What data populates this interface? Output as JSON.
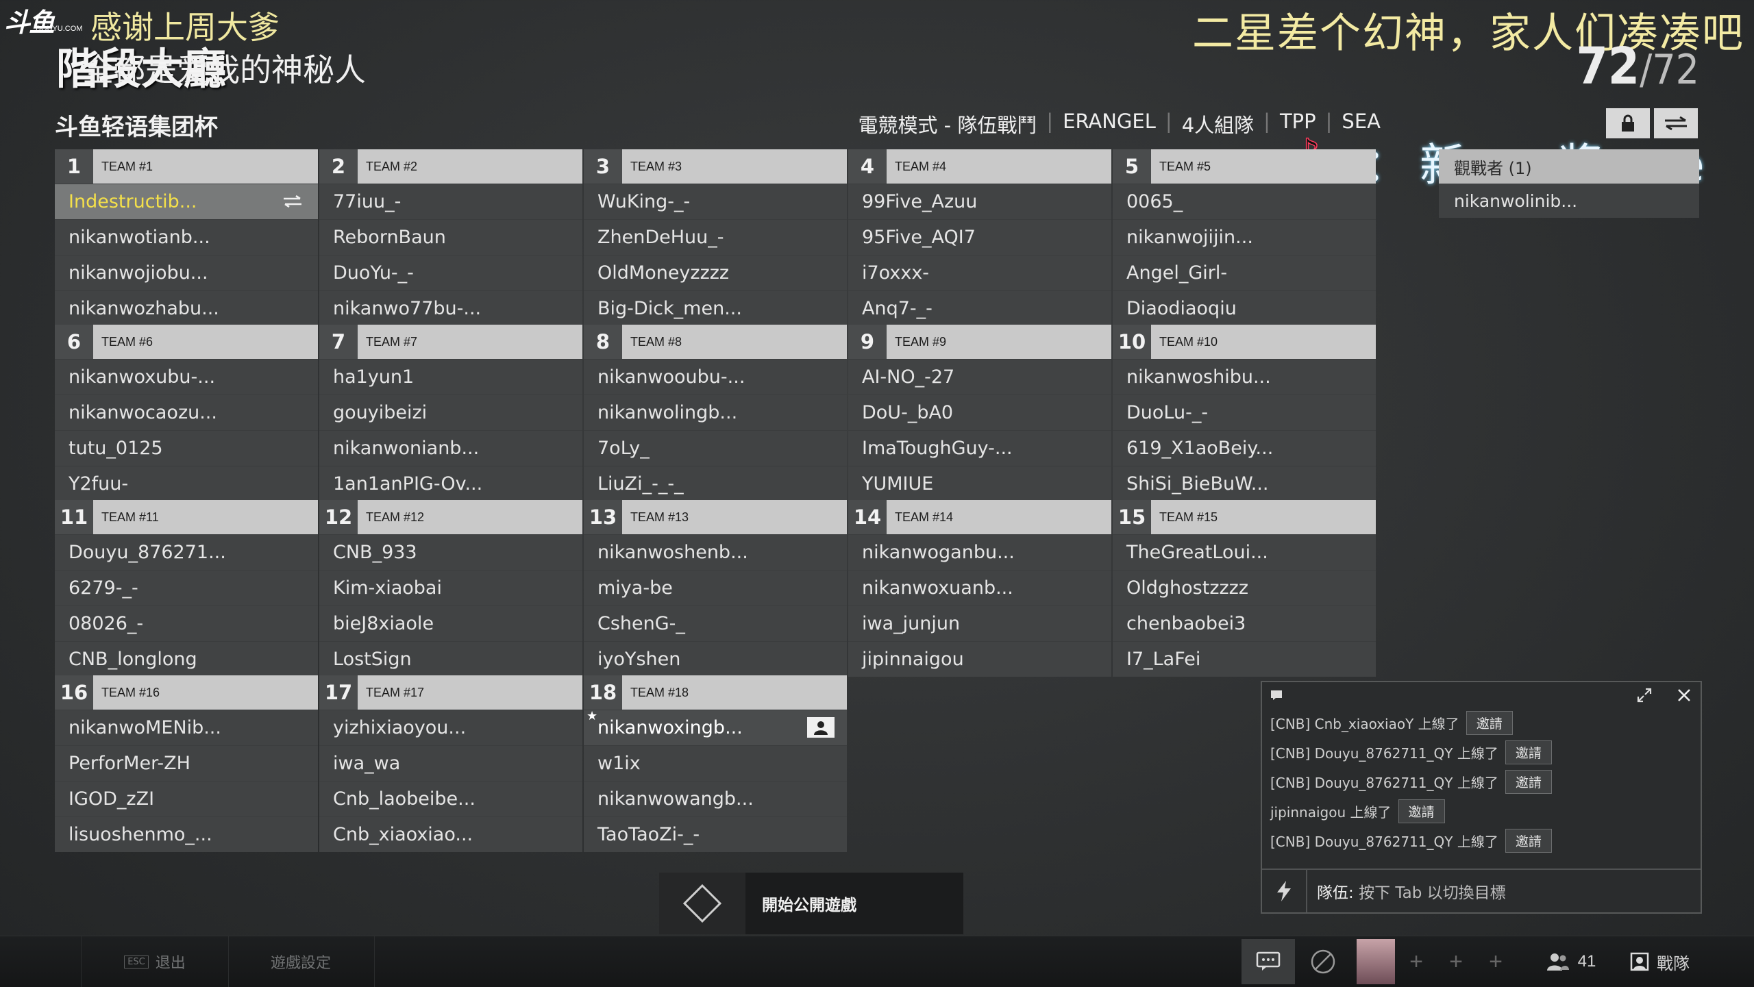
{
  "overlay": {
    "logo_text": "斗鱼",
    "logo_sub": "DOUYU.COM",
    "thanks": "感谢上周大爹",
    "phase": "階段大廳",
    "phase_sub": "全都是爱我的神秘人",
    "banner": "二星差个幻神，家人们凑凑吧",
    "tiktok_text": "：新一 浆 ve"
  },
  "player_count": {
    "current": "72",
    "total": "/72"
  },
  "header": {
    "title": "斗鱼轻语集团杯",
    "mode_items": [
      "電競模式 - 隊伍戰鬥",
      "ERANGEL",
      "4人組隊",
      "TPP",
      "SEA"
    ],
    "lock_icon": "lock-icon",
    "swap_icon": "swap-icon"
  },
  "teams": [
    {
      "num": "1",
      "name": "TEAM #1",
      "players": [
        "Indestructib...",
        "nikanwotianb...",
        "nikanwojiobu...",
        "nikanwozhabu..."
      ]
    },
    {
      "num": "2",
      "name": "TEAM #2",
      "players": [
        "77iuu_-",
        "RebornBaun",
        "DuoYu-_-",
        "nikanwo77bu-..."
      ]
    },
    {
      "num": "3",
      "name": "TEAM #3",
      "players": [
        "WuKing-_-",
        "ZhenDeHuu_-",
        "OldMoneyzzzz",
        "Big-Dick_men..."
      ]
    },
    {
      "num": "4",
      "name": "TEAM #4",
      "players": [
        "99Five_Azuu",
        "95Five_AQI7",
        "i7oxxx-",
        "Anq7-_-"
      ]
    },
    {
      "num": "5",
      "name": "TEAM #5",
      "players": [
        "0065_",
        "nikanwojijin...",
        "Angel_Girl-",
        "Diaodiaoqiu"
      ]
    },
    {
      "num": "6",
      "name": "TEAM #6",
      "players": [
        "nikanwoxubu-...",
        "nikanwocaozu...",
        "tutu_0125",
        "Y2fuu-"
      ]
    },
    {
      "num": "7",
      "name": "TEAM #7",
      "players": [
        "ha1yun1",
        "gouyibeizi",
        "nikanwonianb...",
        "1an1anPIG-Ov..."
      ]
    },
    {
      "num": "8",
      "name": "TEAM #8",
      "players": [
        "nikanwooubu-...",
        "nikanwolingb...",
        "7oLy_",
        "LiuZi_-_-_"
      ]
    },
    {
      "num": "9",
      "name": "TEAM #9",
      "players": [
        "AI-NO_-27",
        "DoU-_bA0",
        "ImaToughGuy-...",
        "YUMIUE"
      ]
    },
    {
      "num": "10",
      "name": "TEAM #10",
      "players": [
        "nikanwoshibu...",
        "DuoLu-_-",
        "619_X1aoBeiy...",
        "ShiSi_BieBuW..."
      ]
    },
    {
      "num": "11",
      "name": "TEAM #11",
      "players": [
        "Douyu_876271...",
        "6279-_-",
        "08026_-",
        "CNB_longlong"
      ]
    },
    {
      "num": "12",
      "name": "TEAM #12",
      "players": [
        "CNB_933",
        "Kim-xiaobai",
        "bieJ8xiaole",
        "LostSign"
      ]
    },
    {
      "num": "13",
      "name": "TEAM #13",
      "players": [
        "nikanwoshenb...",
        "miya-be",
        "CshenG-_",
        "iyoYshen"
      ]
    },
    {
      "num": "14",
      "name": "TEAM #14",
      "players": [
        "nikanwoganbu...",
        "nikanwoxuanb...",
        "iwa_junjun",
        "jipinnaigou"
      ]
    },
    {
      "num": "15",
      "name": "TEAM #15",
      "players": [
        "TheGreatLoui...",
        "Oldghostzzzz",
        "chenbaobei3",
        "I7_LaFei"
      ]
    },
    {
      "num": "16",
      "name": "TEAM #16",
      "players": [
        "nikanwoMENib...",
        "PerforMer-ZH",
        "IGOD_zZI",
        "lisuoshenmo_..."
      ]
    },
    {
      "num": "17",
      "name": "TEAM #17",
      "players": [
        "yizhixiaoyou...",
        "iwa_wa",
        "Cnb_laobeibe...",
        "Cnb_xiaoxiao..."
      ]
    },
    {
      "num": "18",
      "name": "TEAM #18",
      "players": [
        "nikanwoxingb...",
        "w1ix",
        "nikanwowangb...",
        "TaoTaoZi-_-"
      ]
    }
  ],
  "spectators": {
    "header": "觀戰者 (1)",
    "players": [
      "nikanwolinib..."
    ]
  },
  "chat": {
    "messages": [
      {
        "text": "[CNB] Cnb_xiaoxiaoY 上線了",
        "invite": "邀請"
      },
      {
        "text": "[CNB] Douyu_8762711_QY 上線了",
        "invite": "邀請"
      },
      {
        "text": "[CNB] Douyu_8762711_QY 上線了",
        "invite": "邀請"
      },
      {
        "text": "jipinnaigou 上線了",
        "invite": "邀請"
      },
      {
        "text": "[CNB] Douyu_8762711_QY 上線了",
        "invite": "邀請"
      }
    ],
    "input_prefix": "隊伍:",
    "input_hint": "按下 Tab 以切換目標"
  },
  "start_button": {
    "label": "開始公開遊戲"
  },
  "bottom_bar": {
    "esc_key": "ESC",
    "exit_label": "退出",
    "settings_label": "遊戲設定",
    "friends_count": "41",
    "squad_label": "戰隊"
  },
  "colors": {
    "accent_yellow": "#f4e04a",
    "header_bg": "#c9c9c9",
    "row_bg": "#414344"
  }
}
